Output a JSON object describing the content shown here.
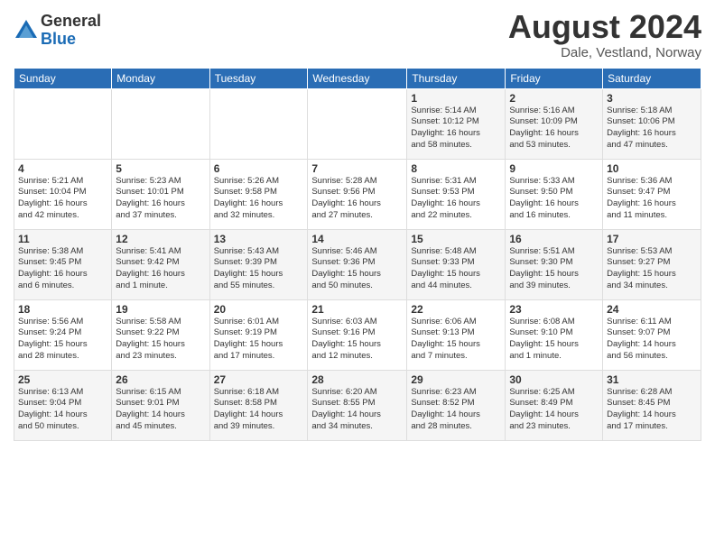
{
  "header": {
    "logo_general": "General",
    "logo_blue": "Blue",
    "month_year": "August 2024",
    "location": "Dale, Vestland, Norway"
  },
  "days_of_week": [
    "Sunday",
    "Monday",
    "Tuesday",
    "Wednesday",
    "Thursday",
    "Friday",
    "Saturday"
  ],
  "weeks": [
    [
      {
        "num": "",
        "info": ""
      },
      {
        "num": "",
        "info": ""
      },
      {
        "num": "",
        "info": ""
      },
      {
        "num": "",
        "info": ""
      },
      {
        "num": "1",
        "info": "Sunrise: 5:14 AM\nSunset: 10:12 PM\nDaylight: 16 hours\nand 58 minutes."
      },
      {
        "num": "2",
        "info": "Sunrise: 5:16 AM\nSunset: 10:09 PM\nDaylight: 16 hours\nand 53 minutes."
      },
      {
        "num": "3",
        "info": "Sunrise: 5:18 AM\nSunset: 10:06 PM\nDaylight: 16 hours\nand 47 minutes."
      }
    ],
    [
      {
        "num": "4",
        "info": "Sunrise: 5:21 AM\nSunset: 10:04 PM\nDaylight: 16 hours\nand 42 minutes."
      },
      {
        "num": "5",
        "info": "Sunrise: 5:23 AM\nSunset: 10:01 PM\nDaylight: 16 hours\nand 37 minutes."
      },
      {
        "num": "6",
        "info": "Sunrise: 5:26 AM\nSunset: 9:58 PM\nDaylight: 16 hours\nand 32 minutes."
      },
      {
        "num": "7",
        "info": "Sunrise: 5:28 AM\nSunset: 9:56 PM\nDaylight: 16 hours\nand 27 minutes."
      },
      {
        "num": "8",
        "info": "Sunrise: 5:31 AM\nSunset: 9:53 PM\nDaylight: 16 hours\nand 22 minutes."
      },
      {
        "num": "9",
        "info": "Sunrise: 5:33 AM\nSunset: 9:50 PM\nDaylight: 16 hours\nand 16 minutes."
      },
      {
        "num": "10",
        "info": "Sunrise: 5:36 AM\nSunset: 9:47 PM\nDaylight: 16 hours\nand 11 minutes."
      }
    ],
    [
      {
        "num": "11",
        "info": "Sunrise: 5:38 AM\nSunset: 9:45 PM\nDaylight: 16 hours\nand 6 minutes."
      },
      {
        "num": "12",
        "info": "Sunrise: 5:41 AM\nSunset: 9:42 PM\nDaylight: 16 hours\nand 1 minute."
      },
      {
        "num": "13",
        "info": "Sunrise: 5:43 AM\nSunset: 9:39 PM\nDaylight: 15 hours\nand 55 minutes."
      },
      {
        "num": "14",
        "info": "Sunrise: 5:46 AM\nSunset: 9:36 PM\nDaylight: 15 hours\nand 50 minutes."
      },
      {
        "num": "15",
        "info": "Sunrise: 5:48 AM\nSunset: 9:33 PM\nDaylight: 15 hours\nand 44 minutes."
      },
      {
        "num": "16",
        "info": "Sunrise: 5:51 AM\nSunset: 9:30 PM\nDaylight: 15 hours\nand 39 minutes."
      },
      {
        "num": "17",
        "info": "Sunrise: 5:53 AM\nSunset: 9:27 PM\nDaylight: 15 hours\nand 34 minutes."
      }
    ],
    [
      {
        "num": "18",
        "info": "Sunrise: 5:56 AM\nSunset: 9:24 PM\nDaylight: 15 hours\nand 28 minutes."
      },
      {
        "num": "19",
        "info": "Sunrise: 5:58 AM\nSunset: 9:22 PM\nDaylight: 15 hours\nand 23 minutes."
      },
      {
        "num": "20",
        "info": "Sunrise: 6:01 AM\nSunset: 9:19 PM\nDaylight: 15 hours\nand 17 minutes."
      },
      {
        "num": "21",
        "info": "Sunrise: 6:03 AM\nSunset: 9:16 PM\nDaylight: 15 hours\nand 12 minutes."
      },
      {
        "num": "22",
        "info": "Sunrise: 6:06 AM\nSunset: 9:13 PM\nDaylight: 15 hours\nand 7 minutes."
      },
      {
        "num": "23",
        "info": "Sunrise: 6:08 AM\nSunset: 9:10 PM\nDaylight: 15 hours\nand 1 minute."
      },
      {
        "num": "24",
        "info": "Sunrise: 6:11 AM\nSunset: 9:07 PM\nDaylight: 14 hours\nand 56 minutes."
      }
    ],
    [
      {
        "num": "25",
        "info": "Sunrise: 6:13 AM\nSunset: 9:04 PM\nDaylight: 14 hours\nand 50 minutes."
      },
      {
        "num": "26",
        "info": "Sunrise: 6:15 AM\nSunset: 9:01 PM\nDaylight: 14 hours\nand 45 minutes."
      },
      {
        "num": "27",
        "info": "Sunrise: 6:18 AM\nSunset: 8:58 PM\nDaylight: 14 hours\nand 39 minutes."
      },
      {
        "num": "28",
        "info": "Sunrise: 6:20 AM\nSunset: 8:55 PM\nDaylight: 14 hours\nand 34 minutes."
      },
      {
        "num": "29",
        "info": "Sunrise: 6:23 AM\nSunset: 8:52 PM\nDaylight: 14 hours\nand 28 minutes."
      },
      {
        "num": "30",
        "info": "Sunrise: 6:25 AM\nSunset: 8:49 PM\nDaylight: 14 hours\nand 23 minutes."
      },
      {
        "num": "31",
        "info": "Sunrise: 6:28 AM\nSunset: 8:45 PM\nDaylight: 14 hours\nand 17 minutes."
      }
    ]
  ]
}
